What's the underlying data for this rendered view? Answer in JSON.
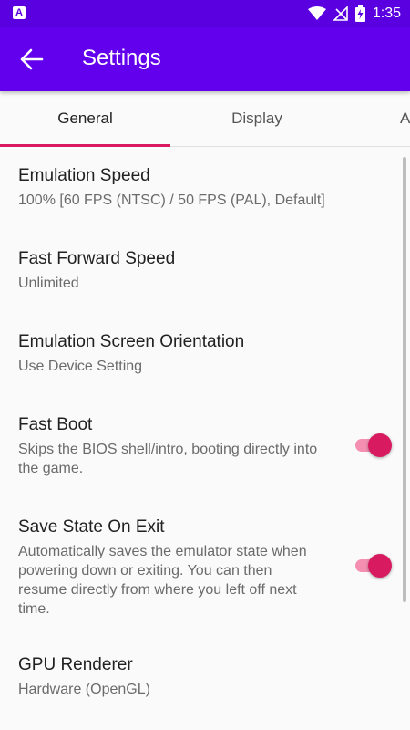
{
  "status_bar": {
    "time": "1:35",
    "app_icon": "A"
  },
  "app_bar": {
    "title": "Settings"
  },
  "tabs": [
    {
      "label": "General",
      "active": true
    },
    {
      "label": "Display",
      "active": false
    },
    {
      "label": "A",
      "active": false
    }
  ],
  "preferences": [
    {
      "title": "Emulation Speed",
      "summary": "100% [60 FPS (NTSC) / 50 FPS (PAL), Default]"
    },
    {
      "title": "Fast Forward Speed",
      "summary": "Unlimited"
    },
    {
      "title": "Emulation Screen Orientation",
      "summary": "Use Device Setting"
    },
    {
      "title": "Fast Boot",
      "summary": "Skips the BIOS shell/intro, booting directly into the game.",
      "checked": true
    },
    {
      "title": "Save State On Exit",
      "summary": "Automatically saves the emulator state when powering down or exiting. You can then resume directly from where you left off next time.",
      "checked": true
    },
    {
      "title": "GPU Renderer",
      "summary": "Hardware (OpenGL)"
    }
  ],
  "colors": {
    "primary": "#6200ee",
    "status_bar": "#5a00e0",
    "accent": "#d81b60"
  },
  "icons": {
    "back": "arrow-left-icon",
    "wifi": "wifi-icon",
    "signal": "no-signal-icon",
    "battery": "battery-charging-icon"
  }
}
